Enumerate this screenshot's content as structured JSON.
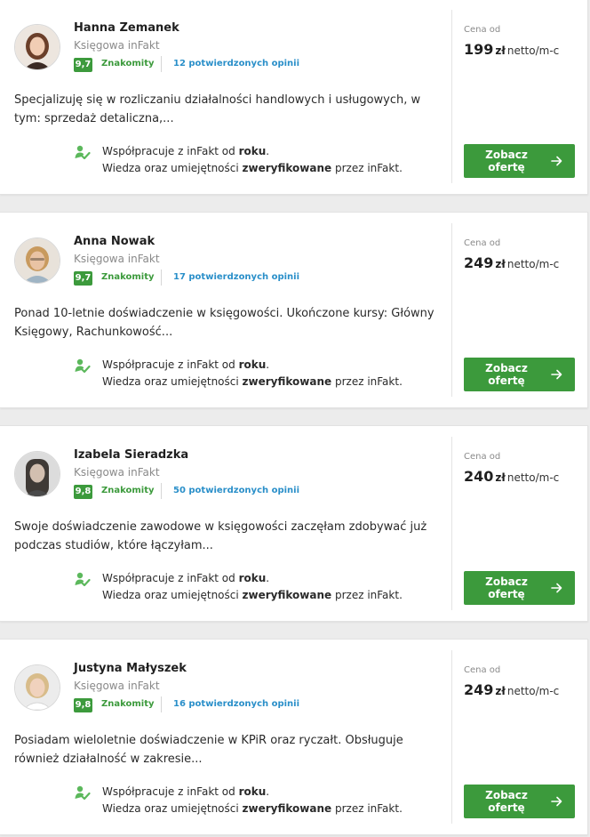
{
  "colors": {
    "accent_green": "#3c9a3c",
    "link_blue": "#2a8fc9",
    "muted_text": "#8a8a8a",
    "background": "#ececec"
  },
  "cards": [
    {
      "name": "Hanna Zemanek",
      "role": "Księgowa inFakt",
      "score": "9,7",
      "rating_label": "Znakomity",
      "reviews": "12 potwierdzonych opinii",
      "description": "Specjalizuję się w rozliczaniu działalności handlowych i usługowych, w tym: sprzedaż detaliczna,...",
      "coop_prefix": "Współpracuje z inFakt od ",
      "coop_bold": "roku",
      "coop_suffix": ".",
      "verified_prefix": "Wiedza oraz umiejętności ",
      "verified_bold": "zweryfikowane",
      "verified_suffix": " przez inFakt.",
      "price_label": "Cena od",
      "price_amount": "199",
      "price_currency": "zł",
      "price_unit": "netto/m-c",
      "cta_label": "Zobacz\nofertę",
      "avatar_icon": "portrait-photo"
    },
    {
      "name": "Anna Nowak",
      "role": "Księgowa inFakt",
      "score": "9,7",
      "rating_label": "Znakomity",
      "reviews": "17 potwierdzonych opinii",
      "description": "Ponad 10-letnie doświadczenie w księgowości. Ukończone kursy: Główny Księgowy, Rachunkowość...",
      "coop_prefix": "Współpracuje z inFakt od ",
      "coop_bold": "roku",
      "coop_suffix": ".",
      "verified_prefix": "Wiedza oraz umiejętności ",
      "verified_bold": "zweryfikowane",
      "verified_suffix": " przez inFakt.",
      "price_label": "Cena od",
      "price_amount": "249",
      "price_currency": "zł",
      "price_unit": "netto/m-c",
      "cta_label": "Zobacz\nofertę",
      "avatar_icon": "portrait-photo"
    },
    {
      "name": "Izabela Sieradzka",
      "role": "Księgowa inFakt",
      "score": "9,8",
      "rating_label": "Znakomity",
      "reviews": "50 potwierdzonych opinii",
      "description": "Swoje doświadczenie zawodowe w księgowości zaczęłam zdobywać już podczas studiów, które łączyłam...",
      "coop_prefix": "Współpracuje z inFakt od ",
      "coop_bold": "roku",
      "coop_suffix": ".",
      "verified_prefix": "Wiedza oraz umiejętności ",
      "verified_bold": "zweryfikowane",
      "verified_suffix": " przez inFakt.",
      "price_label": "Cena od",
      "price_amount": "240",
      "price_currency": "zł",
      "price_unit": "netto/m-c",
      "cta_label": "Zobacz\nofertę",
      "avatar_icon": "portrait-photo"
    },
    {
      "name": "Justyna Małyszek",
      "role": "Księgowa inFakt",
      "score": "9,8",
      "rating_label": "Znakomity",
      "reviews": "16 potwierdzonych opinii",
      "description": "Posiadam wieloletnie doświadczenie w KPiR oraz ryczałt. Obsługuje również działalność w zakresie...",
      "coop_prefix": "Współpracuje z inFakt od ",
      "coop_bold": "roku",
      "coop_suffix": ".",
      "verified_prefix": "Wiedza oraz umiejętności ",
      "verified_bold": "zweryfikowane",
      "verified_suffix": " przez inFakt.",
      "price_label": "Cena od",
      "price_amount": "249",
      "price_currency": "zł",
      "price_unit": "netto/m-c",
      "cta_label": "Zobacz\nofertę",
      "avatar_icon": "portrait-photo"
    }
  ]
}
